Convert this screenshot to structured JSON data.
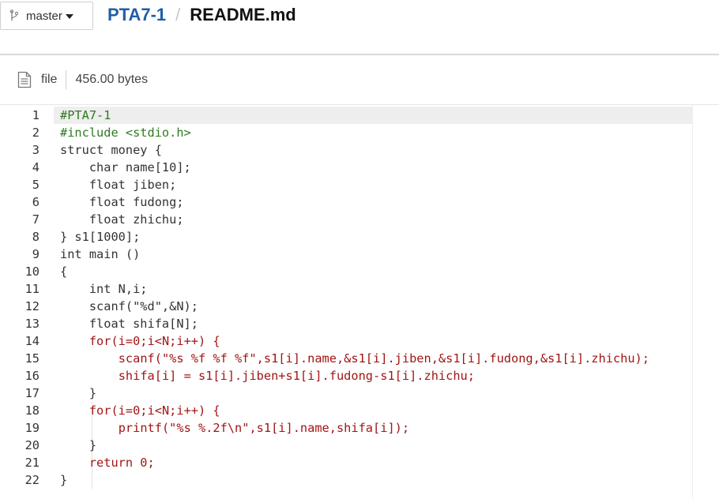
{
  "branch": {
    "label": "master",
    "icon": "branch-icon",
    "caret": "chevron-down-icon"
  },
  "breadcrumb": {
    "repo": "PTA7-1",
    "separator": "/",
    "file": "README.md"
  },
  "file_info": {
    "icon": "file-icon",
    "type_label": "file",
    "size": "456.00 bytes"
  },
  "colors": {
    "repo_link": "#1f5ea8",
    "preprocessor": "#2f7a1f",
    "string_keyword": "#a21515",
    "text": "#333333",
    "highlight_row": "#eeeeee"
  },
  "code": {
    "highlighted_line": 1,
    "lines": [
      {
        "n": "1",
        "tokens": [
          {
            "t": "#PTA7-1",
            "c": "pre"
          }
        ]
      },
      {
        "n": "2",
        "tokens": [
          {
            "t": "#include <stdio.h>",
            "c": "pre"
          }
        ]
      },
      {
        "n": "3",
        "tokens": [
          {
            "t": "struct money {",
            "c": "plain"
          }
        ]
      },
      {
        "n": "4",
        "tokens": [
          {
            "t": "    char name[10];",
            "c": "plain"
          }
        ]
      },
      {
        "n": "5",
        "tokens": [
          {
            "t": "    float jiben;",
            "c": "plain"
          }
        ]
      },
      {
        "n": "6",
        "tokens": [
          {
            "t": "    float fudong;",
            "c": "plain"
          }
        ]
      },
      {
        "n": "7",
        "tokens": [
          {
            "t": "    float zhichu;",
            "c": "plain"
          }
        ]
      },
      {
        "n": "8",
        "tokens": [
          {
            "t": "} s1[1000];",
            "c": "plain"
          }
        ]
      },
      {
        "n": "9",
        "tokens": [
          {
            "t": "int main ()",
            "c": "plain"
          }
        ]
      },
      {
        "n": "10",
        "tokens": [
          {
            "t": "{",
            "c": "plain"
          }
        ]
      },
      {
        "n": "11",
        "tokens": [
          {
            "t": "    int N,i;",
            "c": "plain"
          }
        ]
      },
      {
        "n": "12",
        "tokens": [
          {
            "t": "    scanf(\"%d\",&N);",
            "c": "plain"
          }
        ]
      },
      {
        "n": "13",
        "tokens": [
          {
            "t": "    float shifa[N];",
            "c": "plain"
          }
        ]
      },
      {
        "n": "14",
        "tokens": [
          {
            "t": "    ",
            "c": "plain"
          },
          {
            "t": "for(i=0;i<N;i++) {",
            "c": "str"
          }
        ]
      },
      {
        "n": "15",
        "tokens": [
          {
            "t": "        ",
            "c": "plain"
          },
          {
            "t": "scanf(\"%s %f %f %f\",s1[i].name,&s1[i].jiben,&s1[i].fudong,&s1[i].zhichu);",
            "c": "str"
          }
        ]
      },
      {
        "n": "16",
        "tokens": [
          {
            "t": "        ",
            "c": "plain"
          },
          {
            "t": "shifa[i] = s1[i].jiben+s1[i].fudong-s1[i].zhichu;",
            "c": "str"
          }
        ]
      },
      {
        "n": "17",
        "tokens": [
          {
            "t": "    }",
            "c": "plain"
          }
        ]
      },
      {
        "n": "18",
        "tokens": [
          {
            "t": "    ",
            "c": "plain"
          },
          {
            "t": "for(i=0;i<N;i++) {",
            "c": "str"
          }
        ]
      },
      {
        "n": "19",
        "tokens": [
          {
            "t": "        ",
            "c": "plain"
          },
          {
            "t": "printf(\"%s %.2f\\n\",s1[i].name,shifa[i]);",
            "c": "str"
          }
        ]
      },
      {
        "n": "20",
        "tokens": [
          {
            "t": "    }",
            "c": "plain"
          }
        ]
      },
      {
        "n": "21",
        "tokens": [
          {
            "t": "    ",
            "c": "plain"
          },
          {
            "t": "return 0;",
            "c": "str"
          }
        ]
      },
      {
        "n": "22",
        "tokens": [
          {
            "t": "}",
            "c": "plain"
          }
        ]
      }
    ]
  }
}
